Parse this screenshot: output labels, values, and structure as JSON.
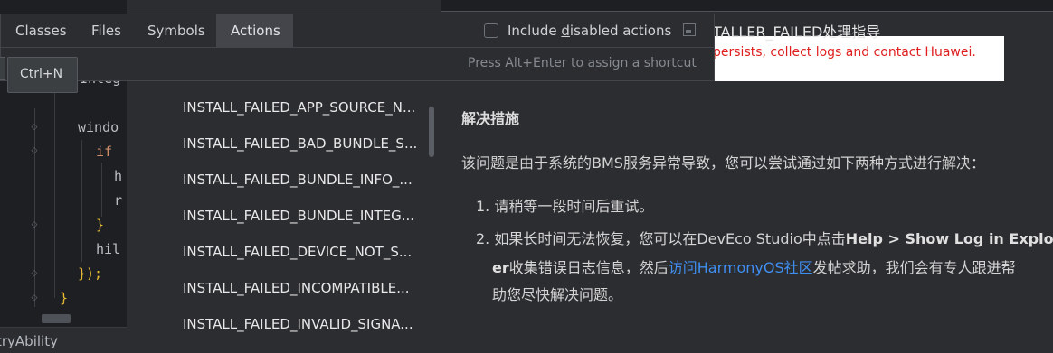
{
  "editor": {
    "lines": [
      {
        "text": "Integ"
      },
      {
        "text": "windo"
      },
      {
        "text": "if"
      },
      {
        "text": "h"
      },
      {
        "text": "r"
      },
      {
        "text": "}"
      },
      {
        "text": "hil"
      },
      {
        "text": "});"
      },
      {
        "text": "}"
      }
    ],
    "status_text": "tryAbility"
  },
  "popup": {
    "tabs": [
      {
        "label": "Classes"
      },
      {
        "label": "Files"
      },
      {
        "label": "Symbols"
      },
      {
        "label": "Actions"
      }
    ],
    "active_tab": "Actions",
    "include_disabled": {
      "label_pre": "Include ",
      "label_mnemonic": "d",
      "label_post": "isabled actions",
      "checked": false
    },
    "hint": "Press Alt+Enter to assign a shortcut",
    "tooltip": "Ctrl+N"
  },
  "results": [
    "INSTALL_FAILED_APP_SOURCE_N...",
    "INSTALL_FAILED_BAD_BUNDLE_S...",
    "INSTALL_FAILED_BUNDLE_INFO_...",
    "INSTALL_FAILED_BUNDLE_INTEG...",
    "INSTALL_FAILED_DEVICE_NOT_S...",
    "INSTALL_FAILED_INCOMPATIBLE...",
    "INSTALL_FAILED_INVALID_SIGNA..."
  ],
  "doc": {
    "title": "TALLER_FAILED处理指导",
    "error_text": "persists, collect logs and contact Huawei.",
    "heading": "解决措施",
    "intro": "该问题是由于系统的BMS服务异常导致，您可以尝试通过如下两种方式进行解决：",
    "step1": "请稍等一段时间后重试。",
    "step2_pre": "如果长时间无法恢复，您可以在DevEco Studio中点击",
    "step2_bold1": "Help > Show Log in Explor",
    "step2_bold2": "er",
    "step2_mid": "收集错误日志信息，然后",
    "step2_link": "访问HarmonyOS社区",
    "step2_post": "发帖求助，我们会有专人跟进帮",
    "step2_end": "助您尽快解决问题。",
    "step1_num": "1.",
    "step2_num": "2."
  },
  "colors": {
    "accent_link": "#3f8ef0",
    "error_red": "#e02020",
    "keyword": "#cf8e6d"
  }
}
